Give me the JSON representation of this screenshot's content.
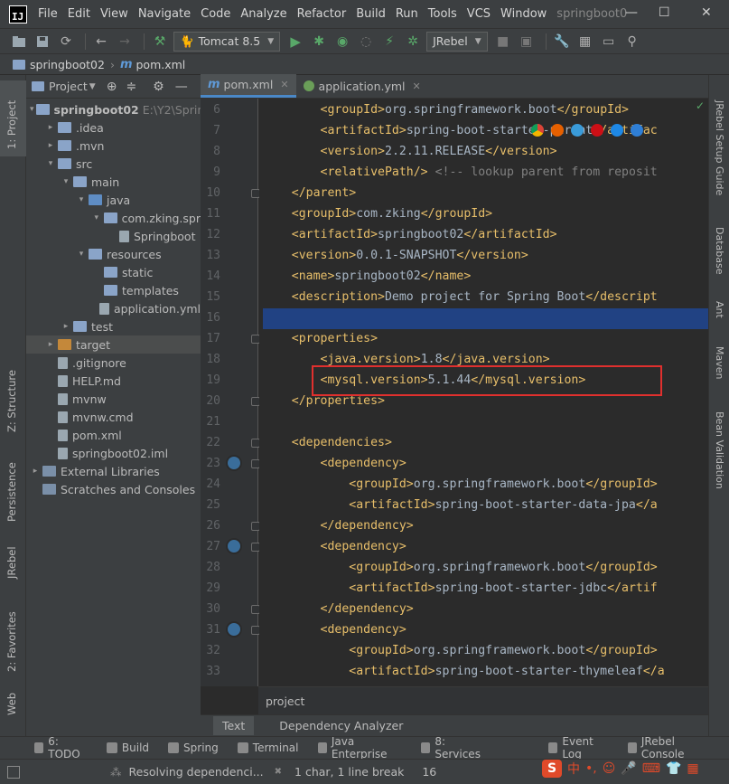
{
  "menubar": {
    "items": [
      "File",
      "Edit",
      "View",
      "Navigate",
      "Code",
      "Analyze",
      "Refactor",
      "Build",
      "Run",
      "Tools",
      "VCS",
      "Window"
    ],
    "window_title": "springboot0",
    "minimize": "—",
    "maximize": "☐",
    "close": "✕"
  },
  "toolbar": {
    "run_config": "Tomcat 8.5",
    "jrebel_combo": "JRebel"
  },
  "navbar": {
    "project": "springboot02",
    "file": "pom.xml"
  },
  "left_strip": {
    "project_tab": "1: Project",
    "structure_tab": "Z: Structure",
    "persistence_tab": "Persistence",
    "jrebel_tab": "JRebel",
    "favorites_tab": "2: Favorites",
    "web_tab": "Web"
  },
  "right_strip": {
    "setup_guide": "JRebel Setup Guide",
    "database": "Database",
    "ant": "Ant",
    "maven": "Maven",
    "bean_validation": "Bean Validation"
  },
  "project_panel": {
    "title": "Project",
    "tree": [
      {
        "label": "springboot02",
        "path": "E:\\Y2\\Sprin",
        "indent": 0,
        "arrow": "▾",
        "icon": "folder"
      },
      {
        "label": ".idea",
        "indent": 1,
        "arrow": "▸",
        "icon": "folder"
      },
      {
        "label": ".mvn",
        "indent": 1,
        "arrow": "▸",
        "icon": "folder"
      },
      {
        "label": "src",
        "indent": 1,
        "arrow": "▾",
        "icon": "folder"
      },
      {
        "label": "main",
        "indent": 2,
        "arrow": "▾",
        "icon": "folder"
      },
      {
        "label": "java",
        "indent": 3,
        "arrow": "▾",
        "icon": "folder-blue"
      },
      {
        "label": "com.zking.spr",
        "indent": 4,
        "arrow": "▾",
        "icon": "folder"
      },
      {
        "label": "Springboot",
        "indent": 5,
        "arrow": "",
        "icon": "file"
      },
      {
        "label": "resources",
        "indent": 3,
        "arrow": "▾",
        "icon": "folder"
      },
      {
        "label": "static",
        "indent": 4,
        "arrow": "",
        "icon": "folder"
      },
      {
        "label": "templates",
        "indent": 4,
        "arrow": "",
        "icon": "folder"
      },
      {
        "label": "application.yml",
        "indent": 4,
        "arrow": "",
        "icon": "file"
      },
      {
        "label": "test",
        "indent": 2,
        "arrow": "▸",
        "icon": "folder"
      },
      {
        "label": "target",
        "indent": 1,
        "arrow": "▸",
        "icon": "folder-orange",
        "selected": true
      },
      {
        "label": ".gitignore",
        "indent": 1,
        "arrow": "",
        "icon": "file"
      },
      {
        "label": "HELP.md",
        "indent": 1,
        "arrow": "",
        "icon": "file"
      },
      {
        "label": "mvnw",
        "indent": 1,
        "arrow": "",
        "icon": "file"
      },
      {
        "label": "mvnw.cmd",
        "indent": 1,
        "arrow": "",
        "icon": "file"
      },
      {
        "label": "pom.xml",
        "indent": 1,
        "arrow": "",
        "icon": "file"
      },
      {
        "label": "springboot02.iml",
        "indent": 1,
        "arrow": "",
        "icon": "file"
      },
      {
        "label": "External Libraries",
        "indent": 0,
        "arrow": "▸",
        "icon": "lib"
      },
      {
        "label": "Scratches and Consoles",
        "indent": 0,
        "arrow": "",
        "icon": "lib"
      }
    ]
  },
  "editor": {
    "tabs": [
      {
        "label": "pom.xml",
        "active": true
      },
      {
        "label": "application.yml",
        "active": false
      }
    ],
    "line_numbers": [
      "6",
      "7",
      "8",
      "9",
      "10",
      "11",
      "12",
      "13",
      "14",
      "15",
      "16",
      "17",
      "18",
      "19",
      "20",
      "21",
      "22",
      "23",
      "24",
      "25",
      "26",
      "27",
      "28",
      "29",
      "30",
      "31",
      "32",
      "33"
    ],
    "lines": [
      "        <groupId>org.springframework.boot</groupId>",
      "        <artifactId>spring-boot-starter-parent</artifac",
      "        <version>2.2.11.RELEASE</version>",
      "        <relativePath/> <!-- lookup parent from reposit",
      "    </parent>",
      "    <groupId>com.zking</groupId>",
      "    <artifactId>springboot02</artifactId>",
      "    <version>0.0.1-SNAPSHOT</version>",
      "    <name>springboot02</name>",
      "    <description>Demo project for Spring Boot</descript",
      "",
      "    <properties>",
      "        <java.version>1.8</java.version>",
      "        <mysql.version>5.1.44</mysql.version>",
      "    </properties>",
      "",
      "    <dependencies>",
      "        <dependency>",
      "            <groupId>org.springframework.boot</groupId>",
      "            <artifactId>spring-boot-starter-data-jpa</a",
      "        </dependency>",
      "        <dependency>",
      "            <groupId>org.springframework.boot</groupId>",
      "            <artifactId>spring-boot-starter-jdbc</artif",
      "        </dependency>",
      "        <dependency>",
      "            <groupId>org.springframework.boot</groupId>",
      "            <artifactId>spring-boot-starter-thymeleaf</a"
    ],
    "breadcrumb": "project",
    "bottom_tabs": [
      "Text",
      "Dependency Analyzer"
    ]
  },
  "tool_windows": [
    "6: TODO",
    "Build",
    "Spring",
    "Terminal",
    "Java Enterprise",
    "8: Services",
    "Event Log",
    "JRebel Console"
  ],
  "statusbar": {
    "progress_text": "Resolving dependenci...",
    "selection_info": "1 char, 1 line break",
    "column": "16"
  },
  "ime": {
    "logo": "S",
    "mode": "中"
  }
}
